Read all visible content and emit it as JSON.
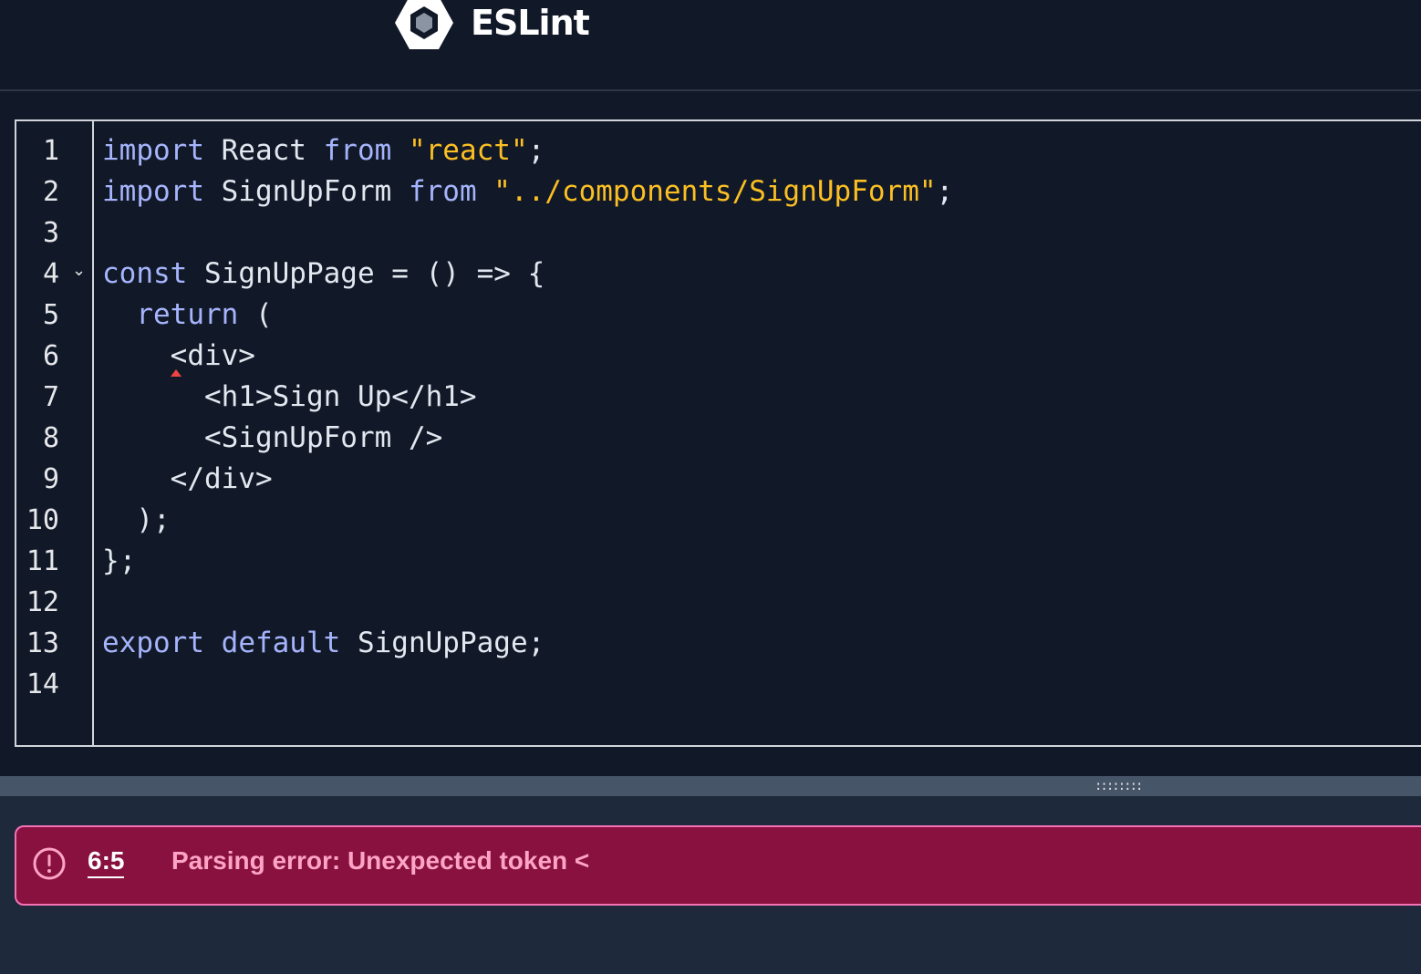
{
  "header": {
    "logo_icon": "eslint-hexagon-icon",
    "title": "ESLint"
  },
  "editor": {
    "line_numbers": [
      "1",
      "2",
      "3",
      "4",
      "5",
      "6",
      "7",
      "8",
      "9",
      "10",
      "11",
      "12",
      "13",
      "14"
    ],
    "fold_icon": "chevron-down-icon",
    "fold_glyph": "⌄",
    "lines": [
      [
        {
          "t": "import",
          "c": "kw"
        },
        {
          "t": " React "
        },
        {
          "t": "from",
          "c": "kw"
        },
        {
          "t": " "
        },
        {
          "t": "\"react\"",
          "c": "str"
        },
        {
          "t": ";"
        }
      ],
      [
        {
          "t": "import",
          "c": "kw"
        },
        {
          "t": " SignUpForm "
        },
        {
          "t": "from",
          "c": "kw"
        },
        {
          "t": " "
        },
        {
          "t": "\"../components/SignUpForm\"",
          "c": "str"
        },
        {
          "t": ";"
        }
      ],
      [],
      [
        {
          "t": "const",
          "c": "kw"
        },
        {
          "t": " SignUpPage = () => {"
        }
      ],
      [
        {
          "t": "  "
        },
        {
          "t": "return",
          "c": "kw"
        },
        {
          "t": " ("
        }
      ],
      [
        {
          "t": "    <div>"
        }
      ],
      [
        {
          "t": "      <h1>Sign Up</h1>"
        }
      ],
      [
        {
          "t": "      <SignUpForm />"
        }
      ],
      [
        {
          "t": "    </div>"
        }
      ],
      [
        {
          "t": "  );"
        }
      ],
      [
        {
          "t": "};"
        }
      ],
      [],
      [
        {
          "t": "export",
          "c": "kw"
        },
        {
          "t": " "
        },
        {
          "t": "default",
          "c": "kw"
        },
        {
          "t": " SignUpPage;"
        }
      ],
      []
    ]
  },
  "resize_handle": {
    "icon": "drag-handle-icon",
    "glyph": "::::::::"
  },
  "error": {
    "icon": "alert-circle-icon",
    "location": "6:5",
    "message": "Parsing error: Unexpected token <"
  },
  "colors": {
    "keyword": "#a5b4fc",
    "string": "#fbbf24",
    "error_bg": "#881140",
    "error_text": "#fda4c4"
  }
}
